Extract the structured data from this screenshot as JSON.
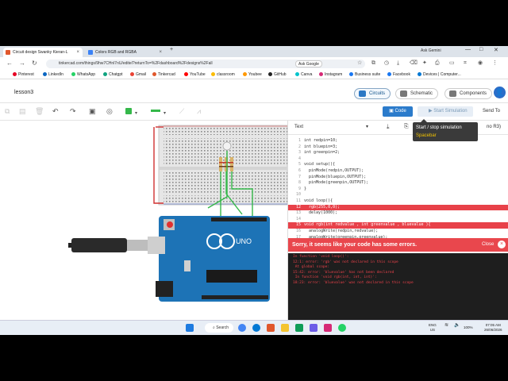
{
  "browser": {
    "tabs": [
      {
        "label": "Circuit design Swanky Kieran-L",
        "color": "#e0572c"
      },
      {
        "label": "Colors RGB and RGBA",
        "color": "#3b82f6"
      }
    ],
    "new_tab": "+",
    "ask_gemini": "Ask Gemini",
    "url": "tinkercad.com/things/9hw7CHnl7nU/editel?returnTo=%2Fdashboard%2Fdesigns%2Fall",
    "ask_google": "Ask Google",
    "bookmarks": [
      "Pinterest",
      "LinkedIn",
      "WhatsApp",
      "Chatgpt",
      "Gmail",
      "Tinkercad",
      "YouTube",
      "classroom",
      "Youbee",
      "GitHub",
      "Canva",
      "Instagram",
      "Business suite",
      "Facebook",
      "Devices | Computer..."
    ]
  },
  "tinkercad": {
    "project_title": "lesson3",
    "circuits_label": "Circuits",
    "schematic_label": "Schematic",
    "components_label": "Components",
    "code_button": "Code",
    "start_sim_button": "Start Simulation",
    "send_to": "Send To",
    "tooltip_title": "Start / stop simulation",
    "tooltip_key": "Spacebar",
    "code_mode": "Text",
    "board_label": "no R3)",
    "arduino_text": "UNO"
  },
  "code": {
    "lines": [
      {
        "no": "1",
        "text": "int redpin=10;",
        "err": false
      },
      {
        "no": "2",
        "text": "int bluepin=3;",
        "err": false
      },
      {
        "no": "3",
        "text": "int greenpin=2;",
        "err": false
      },
      {
        "no": "4",
        "text": "",
        "err": false
      },
      {
        "no": "5",
        "text": "void setup(){",
        "err": false
      },
      {
        "no": "6",
        "text": "  pinMode(redpin,OUTPUT);",
        "err": false
      },
      {
        "no": "7",
        "text": "  pinMode(bluepin,OUTPUT);",
        "err": false
      },
      {
        "no": "8",
        "text": "  pinMode(greenpin,OUTPUT);",
        "err": false
      },
      {
        "no": "9",
        "text": "}",
        "err": false
      },
      {
        "no": "10",
        "text": "",
        "err": false
      },
      {
        "no": "11",
        "text": "void loop(){",
        "err": false
      },
      {
        "no": "12",
        "text": "  rgb(255,0,0);",
        "err": true
      },
      {
        "no": "13",
        "text": "  delay(1000);",
        "err": false
      },
      {
        "no": "14",
        "text": "",
        "err": false
      },
      {
        "no": "15",
        "text": "void rgb(int redvalue , int greenvalue , bluevalue ){",
        "err": true
      },
      {
        "no": "16",
        "text": "  analogWrite(redpin,redvalue);",
        "err": false
      },
      {
        "no": "17",
        "text": "  analogWrite(greenpin,greenvalue);",
        "err": false
      },
      {
        "no": "18",
        "text": "  analogWrite(bluepin,bluevalue);",
        "err": true
      }
    ]
  },
  "errors": {
    "header": "Sorry, it seems like your code has some errors.",
    "close_label": "Close",
    "log": [
      "In function 'void loop()':",
      "12:1: error: 'rgb' was not declared in this scope",
      " At global scope:",
      "15:42: error: 'bluevalue' has not been declared",
      " In function 'void rgb(int, int, int)':",
      "18:23: error: 'bluevalue' was not declared in this scope"
    ]
  },
  "taskbar": {
    "search": "Search",
    "lang": "ENG",
    "region": "US",
    "battery": "100%",
    "time": "07:05 AM",
    "date": "26/06/2026"
  },
  "colors": {
    "accent": "#2b7bcb",
    "error": "#e84149",
    "arduino": "#1d73b6"
  },
  "icons": [
    "back-icon",
    "forward-icon",
    "reload-icon",
    "star-icon",
    "download-icon",
    "gear-icon",
    "play-icon",
    "close-icon",
    "windows-start-icon"
  ]
}
